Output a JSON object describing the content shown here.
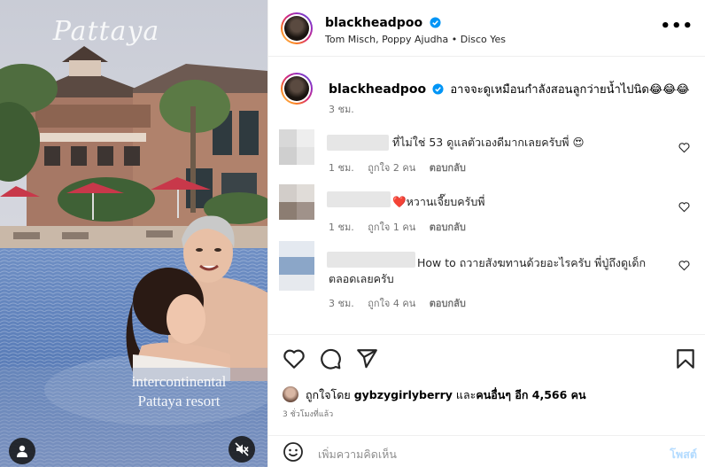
{
  "media": {
    "title_overlay": "Pattaya",
    "subtitle_overlay_line1": "intercontinental",
    "subtitle_overlay_line2": "Pattaya resort",
    "user_icon": "user-icon",
    "mute_icon": "speaker-muted-icon"
  },
  "header": {
    "username": "blackheadpoo",
    "audio": "Tom Misch, Poppy Ajudha • Disco Yes",
    "more": "•••"
  },
  "caption": {
    "username": "blackheadpoo",
    "text": "อาจจะดูเหมือนกำลังสอนลูกว่ายน้ำไปนิด😂😂😂",
    "time": "3 ชม."
  },
  "comments": [
    {
      "text": "ที่ไม่ใช่ 53 ดูแลตัวเองดีมากเลยครับพี่ 😍",
      "time": "1 ชม.",
      "likes": "ถูกใจ 2 คน",
      "reply": "ตอบกลับ"
    },
    {
      "text": "❤️หวานเจี๊ยบครับพี่",
      "time": "1 ชม.",
      "likes": "ถูกใจ 1 คน",
      "reply": "ตอบกลับ"
    },
    {
      "text_line1": "How to ถวายสังฆทานด้วยอะไรครับ พี่ปู่ถึงดูเด็ก",
      "text_line2": "ตลอดเลยครับ",
      "time": "3 ชม.",
      "likes": "ถูกใจ 4 คน",
      "reply": "ตอบกลับ"
    }
  ],
  "actions": {
    "like_icon": "heart-icon",
    "comment_icon": "comment-icon",
    "share_icon": "send-icon",
    "save_icon": "bookmark-icon"
  },
  "likes": {
    "prefix": "ถูกใจโดย",
    "user": "gybzygirlyberry",
    "and": "และ",
    "others": "คนอื่นๆ อีก 4,566 คน"
  },
  "posted": "3 ชั่วโมงที่แล้ว",
  "add_comment": {
    "emoji_icon": "smiley-icon",
    "placeholder": "เพิ่มความคิดเห็น",
    "post_label": "โพสต์"
  },
  "colors": {
    "verified": "#0095f6",
    "heart_red": "#ed4956",
    "post_disabled": "#b3dbff",
    "pool": "#5a7fb8"
  }
}
